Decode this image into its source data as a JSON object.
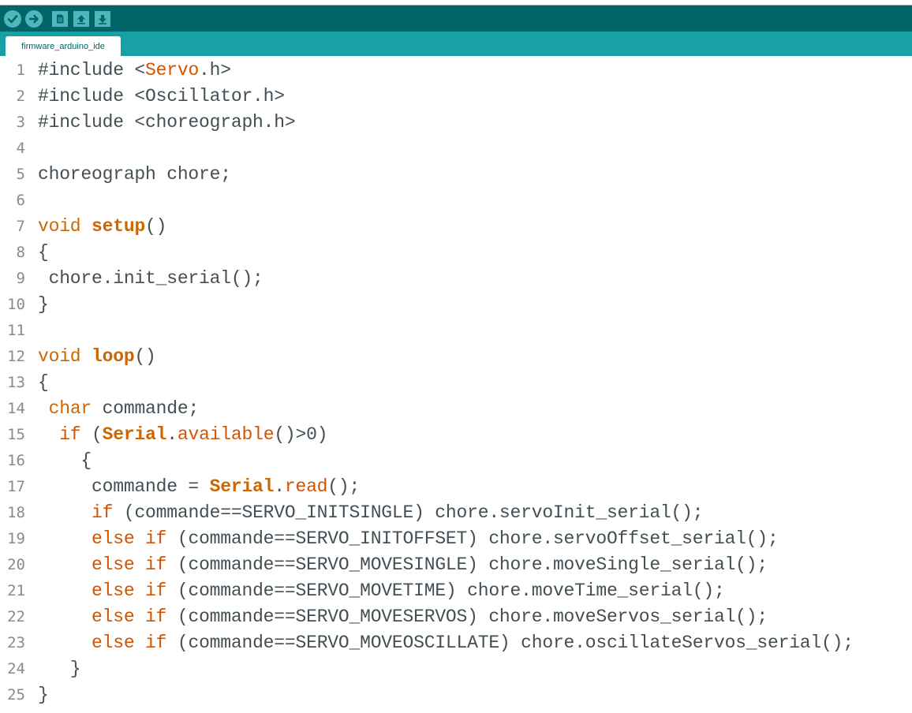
{
  "window": {
    "title": ""
  },
  "toolbar": {
    "buttons": [
      {
        "name": "verify",
        "icon": "checkmark-icon"
      },
      {
        "name": "upload",
        "icon": "right-arrow-icon"
      },
      {
        "name": "new",
        "icon": "new-file-icon"
      },
      {
        "name": "open",
        "icon": "up-arrow-icon"
      },
      {
        "name": "save",
        "icon": "down-arrow-icon"
      }
    ]
  },
  "tabs": [
    {
      "label": "firmware_arduino_ide",
      "active": true
    }
  ],
  "colors": {
    "toolbar": "#006468",
    "tabbar": "#17a1a5",
    "button": "#4db7bb",
    "keyword": "#d35400",
    "text": "#434f54",
    "line_number": "#8a8a8a"
  },
  "editor": {
    "line_numbers": [
      "1",
      "2",
      "3",
      "4",
      "5",
      "6",
      "7",
      "8",
      "9",
      "10",
      "11",
      "12",
      "13",
      "14",
      "15",
      "16",
      "17",
      "18",
      "19",
      "20",
      "21",
      "22",
      "23",
      "24",
      "25"
    ],
    "lines": [
      [
        {
          "t": "#include <"
        },
        {
          "t": "Servo",
          "c": "cls"
        },
        {
          "t": ".h>"
        }
      ],
      [
        {
          "t": "#include <Oscillator.h>"
        }
      ],
      [
        {
          "t": "#include <choreograph.h>"
        }
      ],
      [
        {
          "t": ""
        }
      ],
      [
        {
          "t": "choreograph chore;"
        }
      ],
      [
        {
          "t": ""
        }
      ],
      [
        {
          "t": "void",
          "c": "ty"
        },
        {
          "t": " "
        },
        {
          "t": "setup",
          "c": "kw2"
        },
        {
          "t": "()"
        }
      ],
      [
        {
          "t": "{"
        }
      ],
      [
        {
          "t": " chore.init_serial();"
        }
      ],
      [
        {
          "t": "}"
        }
      ],
      [
        {
          "t": ""
        }
      ],
      [
        {
          "t": "void",
          "c": "ty"
        },
        {
          "t": " "
        },
        {
          "t": "loop",
          "c": "kw2"
        },
        {
          "t": "()"
        }
      ],
      [
        {
          "t": "{"
        }
      ],
      [
        {
          "t": " "
        },
        {
          "t": "char",
          "c": "ty"
        },
        {
          "t": " commande;"
        }
      ],
      [
        {
          "t": "  "
        },
        {
          "t": "if",
          "c": "kw"
        },
        {
          "t": " ("
        },
        {
          "t": "Serial",
          "c": "kw2"
        },
        {
          "t": "."
        },
        {
          "t": "available",
          "c": "fn"
        },
        {
          "t": "()>0)"
        }
      ],
      [
        {
          "t": "    {"
        }
      ],
      [
        {
          "t": "     commande = "
        },
        {
          "t": "Serial",
          "c": "kw2"
        },
        {
          "t": "."
        },
        {
          "t": "read",
          "c": "fn"
        },
        {
          "t": "();"
        }
      ],
      [
        {
          "t": "     "
        },
        {
          "t": "if",
          "c": "kw"
        },
        {
          "t": " (commande==SERVO_INITSINGLE) chore.servoInit_serial();"
        }
      ],
      [
        {
          "t": "     "
        },
        {
          "t": "else",
          "c": "kw"
        },
        {
          "t": " "
        },
        {
          "t": "if",
          "c": "kw"
        },
        {
          "t": " (commande==SERVO_INITOFFSET) chore.servoOffset_serial();"
        }
      ],
      [
        {
          "t": "     "
        },
        {
          "t": "else",
          "c": "kw"
        },
        {
          "t": " "
        },
        {
          "t": "if",
          "c": "kw"
        },
        {
          "t": " (commande==SERVO_MOVESINGLE) chore.moveSingle_serial();"
        }
      ],
      [
        {
          "t": "     "
        },
        {
          "t": "else",
          "c": "kw"
        },
        {
          "t": " "
        },
        {
          "t": "if",
          "c": "kw"
        },
        {
          "t": " (commande==SERVO_MOVETIME) chore.moveTime_serial();"
        }
      ],
      [
        {
          "t": "     "
        },
        {
          "t": "else",
          "c": "kw"
        },
        {
          "t": " "
        },
        {
          "t": "if",
          "c": "kw"
        },
        {
          "t": " (commande==SERVO_MOVESERVOS) chore.moveServos_serial();"
        }
      ],
      [
        {
          "t": "     "
        },
        {
          "t": "else",
          "c": "kw"
        },
        {
          "t": " "
        },
        {
          "t": "if",
          "c": "kw"
        },
        {
          "t": " (commande==SERVO_MOVEOSCILLATE) chore.oscillateServos_serial();"
        }
      ],
      [
        {
          "t": "   }"
        }
      ],
      [
        {
          "t": "}"
        }
      ]
    ]
  }
}
